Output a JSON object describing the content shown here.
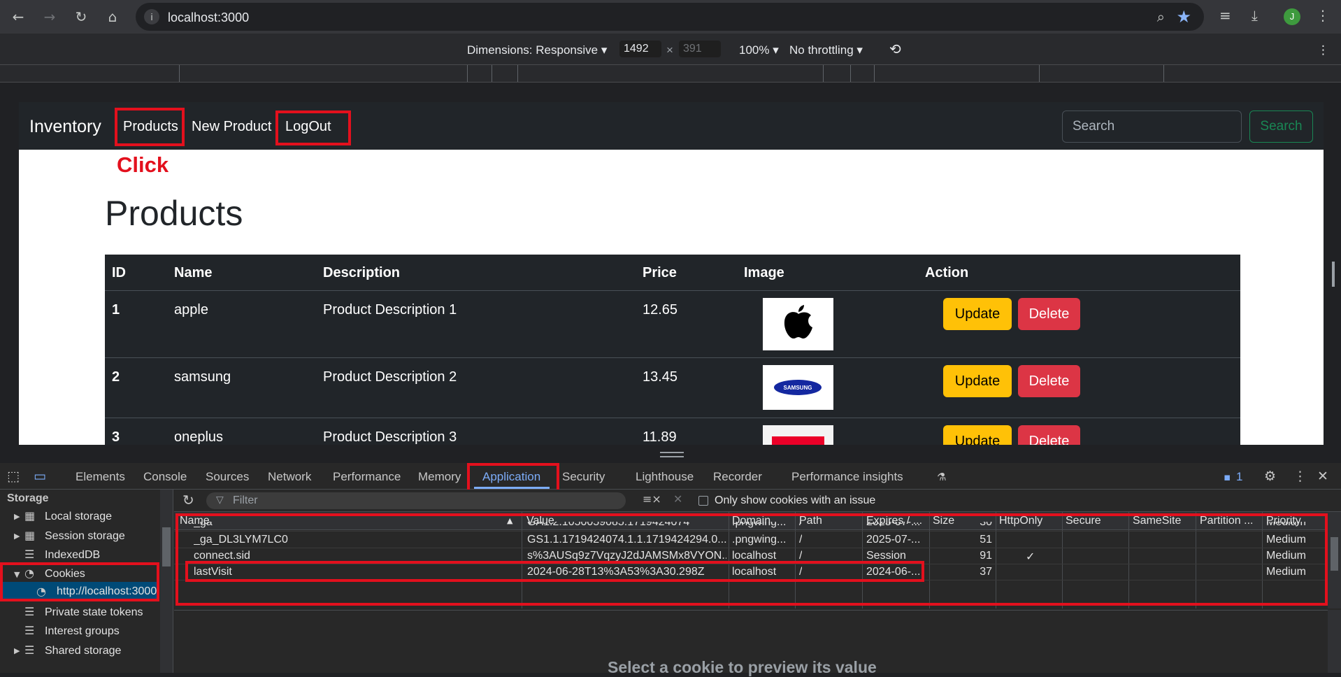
{
  "browser": {
    "url": "localhost:3000",
    "avatar_letter": "J"
  },
  "device_toolbar": {
    "dimensions_label": "Dimensions: Responsive",
    "width": "1492",
    "times": "×",
    "height_placeholder": "391",
    "zoom": "100%",
    "throttling": "No throttling"
  },
  "app": {
    "brand": "Inventory",
    "nav": [
      "Products",
      "New Product",
      "LogOut"
    ],
    "search_placeholder": "Search",
    "search_button": "Search",
    "annotation": "Click",
    "page_title": "Products",
    "table": {
      "headers": [
        "ID",
        "Name",
        "Description",
        "Price",
        "Image",
        "Action"
      ],
      "rows": [
        {
          "id": "1",
          "name": "apple",
          "description": "Product Description 1",
          "price": "12.65",
          "image": "apple-logo"
        },
        {
          "id": "2",
          "name": "samsung",
          "description": "Product Description 2",
          "price": "13.45",
          "image": "samsung-logo"
        },
        {
          "id": "3",
          "name": "oneplus",
          "description": "Product Description 3",
          "price": "11.89",
          "image": "oneplus-logo"
        }
      ],
      "update_label": "Update",
      "delete_label": "Delete",
      "samsung_text": "SAMSUNG"
    },
    "colors": {
      "annotation_red": "#e3101d",
      "update": "#ffc107",
      "delete": "#dc3545",
      "search_green": "#198754"
    }
  },
  "devtools": {
    "tabs": [
      "Elements",
      "Console",
      "Sources",
      "Network",
      "Performance",
      "Memory",
      "Application",
      "Security",
      "Lighthouse",
      "Recorder",
      "Performance insights"
    ],
    "active_tab": "Application",
    "issues_count": "1",
    "sidebar": {
      "heading": "Storage",
      "items": [
        "Local storage",
        "Session storage",
        "IndexedDB",
        "Cookies",
        "http://localhost:3000",
        "Private state tokens",
        "Interest groups",
        "Shared storage"
      ]
    },
    "filter_placeholder": "Filter",
    "only_issues_label": "Only show cookies with an issue",
    "cookie_columns": [
      "Name",
      "Value",
      "Domain",
      "Path",
      "Expires / ...",
      "Size",
      "HttpOnly",
      "Secure",
      "SameSite",
      "Partition ...",
      "Priority"
    ],
    "cookies": [
      {
        "name": "_ga",
        "value": "GA1.2.1050059085.1719424074",
        "domain": ".pngwing...",
        "path": "/",
        "expires": "2025-07-...",
        "size": "30",
        "httponly": "",
        "priority": "Medium"
      },
      {
        "name": "_ga_DL3LYM7LC0",
        "value": "GS1.1.1719424074.1.1.1719424294.0....",
        "domain": ".pngwing...",
        "path": "/",
        "expires": "2025-07-...",
        "size": "51",
        "httponly": "",
        "priority": "Medium"
      },
      {
        "name": "connect.sid",
        "value": "s%3AUSq9z7VqzyJ2dJAMSMx8VYON...",
        "domain": "localhost",
        "path": "/",
        "expires": "Session",
        "size": "91",
        "httponly": "✓",
        "priority": "Medium"
      },
      {
        "name": "lastVisit",
        "value": "2024-06-28T13%3A53%3A30.298Z",
        "domain": "localhost",
        "path": "/",
        "expires": "2024-06-...",
        "size": "37",
        "httponly": "",
        "priority": "Medium"
      }
    ],
    "preview_text": "Select a cookie to preview its value"
  }
}
